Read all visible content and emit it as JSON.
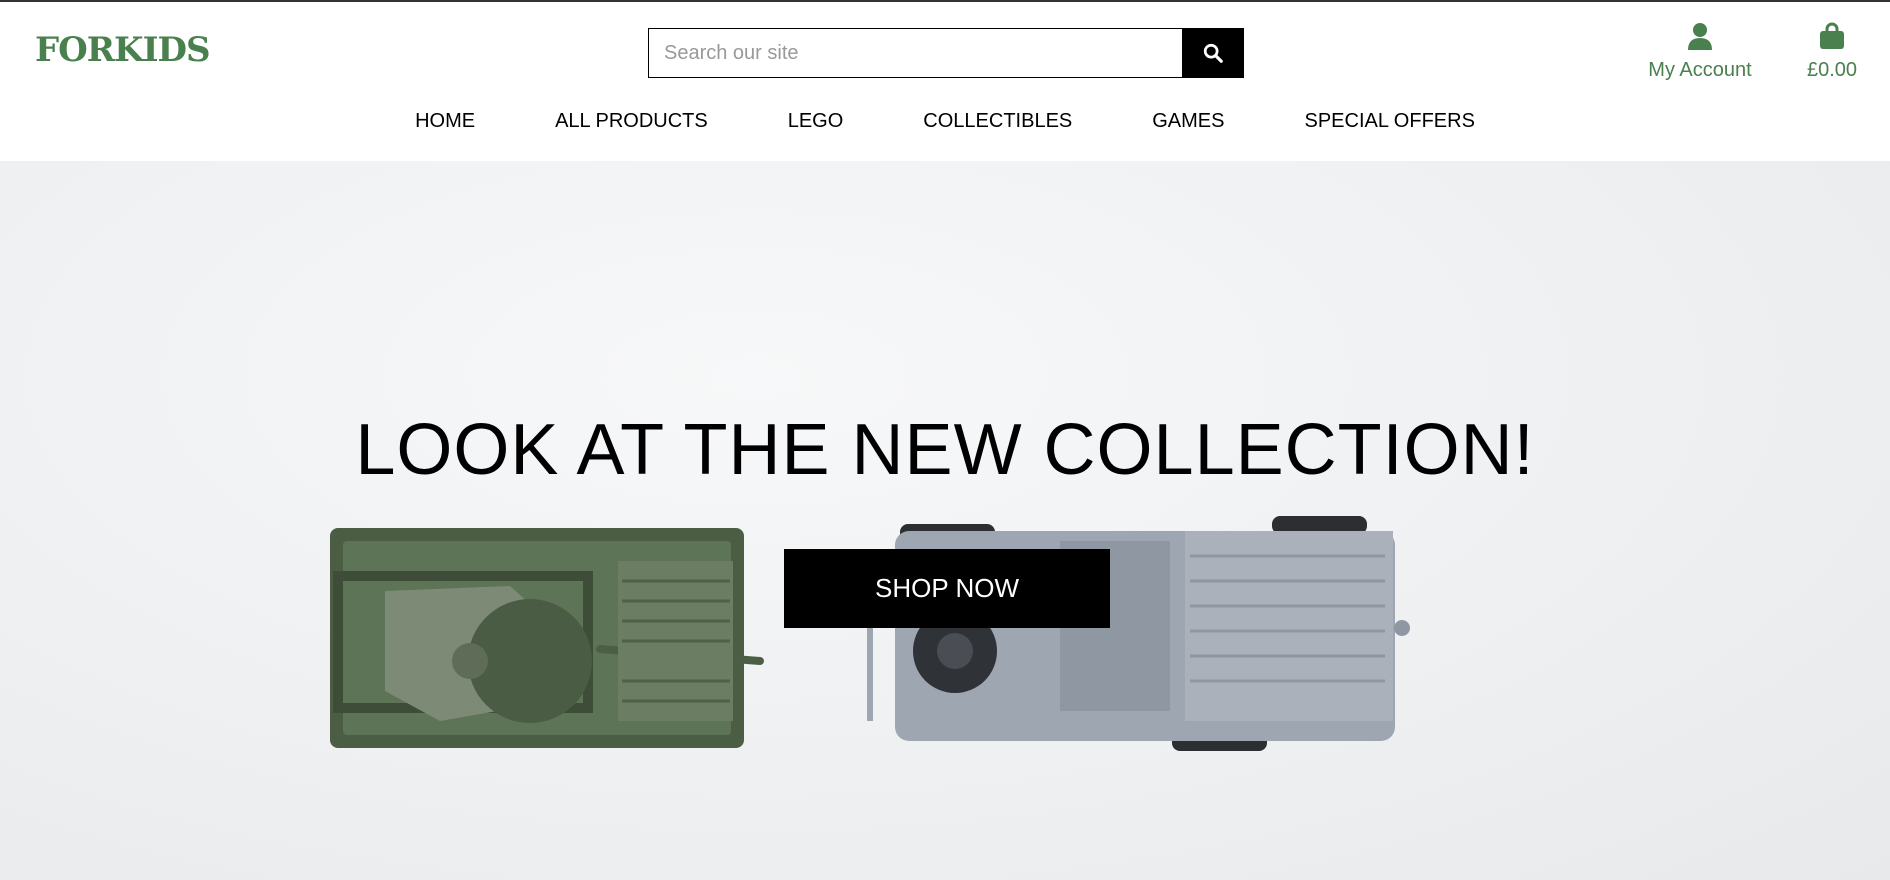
{
  "brand": {
    "logo_text": "FORKIDS",
    "accent_color": "#4a7f4e"
  },
  "search": {
    "placeholder": "Search our site",
    "value": "",
    "icon": "search-icon"
  },
  "account": {
    "label": "My Account",
    "icon": "user-icon"
  },
  "bag": {
    "total": "£0.00",
    "icon": "shopping-bag-icon"
  },
  "nav": {
    "items": [
      {
        "label": "HOME"
      },
      {
        "label": "ALL PRODUCTS"
      },
      {
        "label": "LEGO"
      },
      {
        "label": "COLLECTIBLES"
      },
      {
        "label": "GAMES"
      },
      {
        "label": "SPECIAL OFFERS"
      }
    ]
  },
  "hero": {
    "title": "LOOK AT THE NEW COLLECTION!",
    "cta_label": "SHOP NOW"
  }
}
